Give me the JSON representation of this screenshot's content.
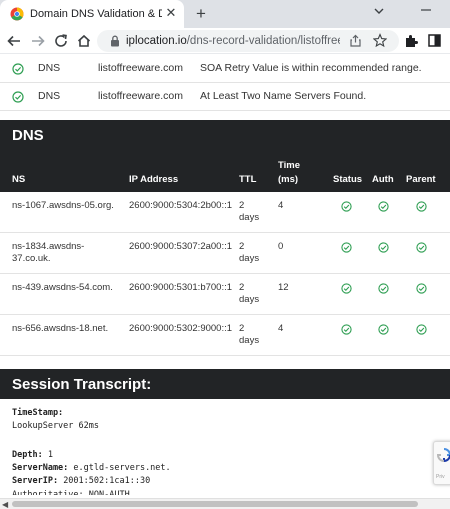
{
  "browser": {
    "tab_title": "Domain DNS Validation & DNS H",
    "close_glyph": "✕",
    "new_tab_glyph": "+",
    "url_host": "iplocation.io",
    "url_path": "/dns-record-validation/listoffree..."
  },
  "checks": [
    {
      "type": "DNS",
      "source": "listoffreeware.com",
      "message": "SOA Retry Value is within recommended range."
    },
    {
      "type": "DNS",
      "source": "listoffreeware.com",
      "message": "At Least Two Name Servers Found."
    }
  ],
  "dns_section": {
    "title": "DNS",
    "headers": {
      "ns": "NS",
      "ip": "IP Address",
      "ttl": "TTL",
      "time_1": "Time",
      "time_2": "(ms)",
      "status": "Status",
      "auth": "Auth",
      "parent": "Parent"
    },
    "rows": [
      {
        "ns_1": "ns-1067.awsdns-05.org.",
        "ns_2": "",
        "ip": "2600:9000:5304:2b00::1",
        "ttl_1": "2",
        "ttl_2": "days",
        "time": "4",
        "status": "ok",
        "auth": "ok",
        "parent": "ok"
      },
      {
        "ns_1": "ns-1834.awsdns-",
        "ns_2": "37.co.uk.",
        "ip": "2600:9000:5307:2a00::1",
        "ttl_1": "2",
        "ttl_2": "days",
        "time": "0",
        "status": "ok",
        "auth": "ok",
        "parent": "ok"
      },
      {
        "ns_1": "ns-439.awsdns-54.com.",
        "ns_2": "",
        "ip": "2600:9000:5301:b700::1",
        "ttl_1": "2",
        "ttl_2": "days",
        "time": "12",
        "status": "ok",
        "auth": "ok",
        "parent": "ok"
      },
      {
        "ns_1": "ns-656.awsdns-18.net.",
        "ns_2": "",
        "ip": "2600:9000:5302:9000::1",
        "ttl_1": "2",
        "ttl_2": "days",
        "time": "4",
        "status": "ok",
        "auth": "ok",
        "parent": "ok"
      }
    ]
  },
  "transcript_section": {
    "title": "Session Transcript:",
    "timestamp_label": "TimeStamp:",
    "timestamp_value": "LookupServer 62ms",
    "depth_label": "Depth:",
    "depth_value": "1",
    "server_label": "ServerName:",
    "server_value": "e.gtld-servers.net.",
    "ip_label": "ServerIP:",
    "ip_value": "2001:502:1ca1::30",
    "partial_label": "Authoritative: NON-AUTH"
  },
  "recaptcha_text": "Priv",
  "colors": {
    "header_bg": "#222426",
    "check_green": "#2e9e52",
    "tab_strip": "#dee1e6"
  },
  "icons": [
    "chrome-favicon",
    "close-icon",
    "new-tab-icon",
    "back-arrow-icon",
    "forward-arrow-icon",
    "reload-icon",
    "home-icon",
    "lock-icon",
    "share-icon",
    "star-icon",
    "puzzle-icon",
    "side-panel-icon",
    "check-circle-icon",
    "recaptcha-icon"
  ]
}
